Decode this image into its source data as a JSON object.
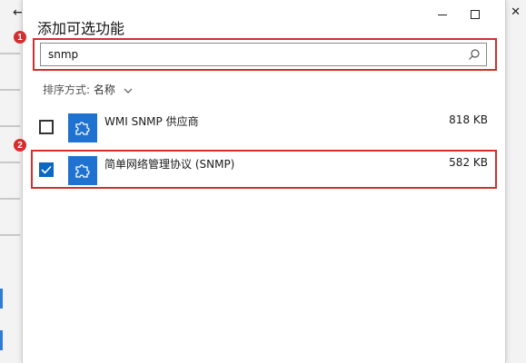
{
  "background": {
    "back_glyph": "←",
    "close_glyph": "✕"
  },
  "dialog": {
    "title": "添加可选功能",
    "window_controls": {
      "minimize": "minimize",
      "maximize": "maximize"
    },
    "search": {
      "value": "snmp",
      "icon": "search-icon"
    },
    "sort": {
      "label": "排序方式:",
      "value": "名称"
    },
    "items": [
      {
        "name": "WMI SNMP 供应商",
        "size": "818 KB",
        "checked": false
      },
      {
        "name": "简单网络管理协议 (SNMP)",
        "size": "582 KB",
        "checked": true
      }
    ]
  },
  "annotations": {
    "marker_1": "1",
    "marker_2": "2",
    "color": "#d32f2f"
  },
  "colors": {
    "accent": "#0a67c2",
    "app_tile": "#1f72cf"
  }
}
